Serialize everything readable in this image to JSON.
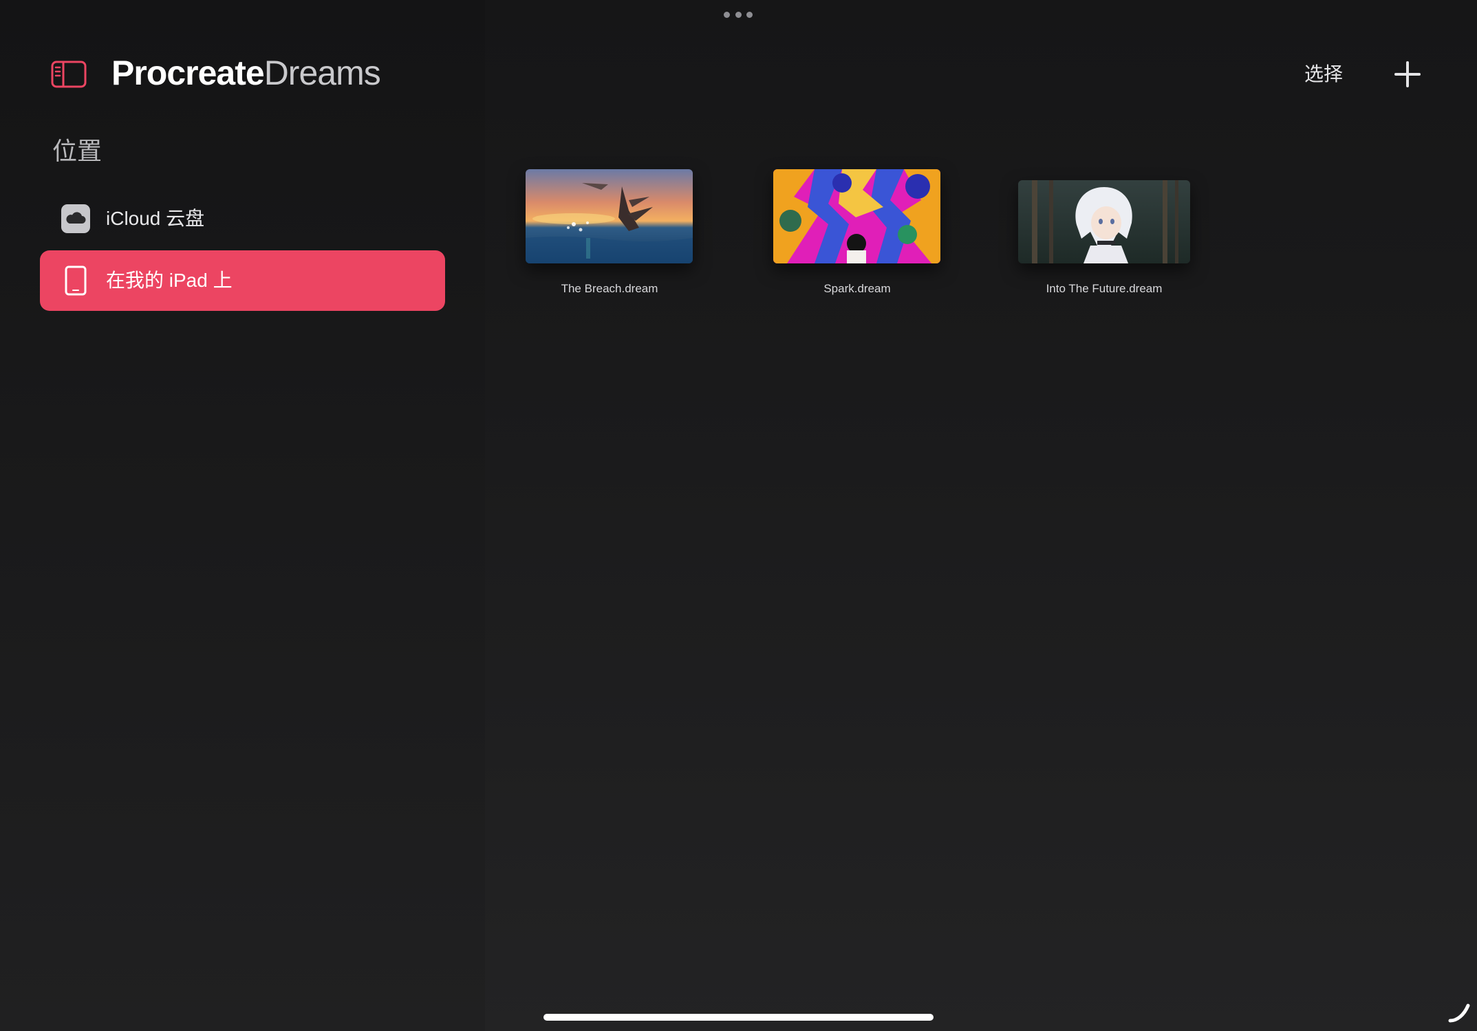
{
  "app": {
    "brand_bold": "Procreate",
    "brand_light": "Dreams",
    "accent_color": "#ec4562"
  },
  "sidebar": {
    "toggle_icon": "sidebar-toggle-icon",
    "section_title": "位置",
    "locations": [
      {
        "label": "iCloud 云盘",
        "icon": "cloud-icon",
        "selected": false
      },
      {
        "label": "在我的 iPad 上",
        "icon": "ipad-icon",
        "selected": true
      }
    ]
  },
  "toolbar": {
    "select_label": "选择",
    "add_icon": "plus-icon",
    "multitask_icon": "ellipsis-icon"
  },
  "files": [
    {
      "name": "The Breach.dream"
    },
    {
      "name": "Spark.dream"
    },
    {
      "name": "Into The Future.dream"
    }
  ]
}
